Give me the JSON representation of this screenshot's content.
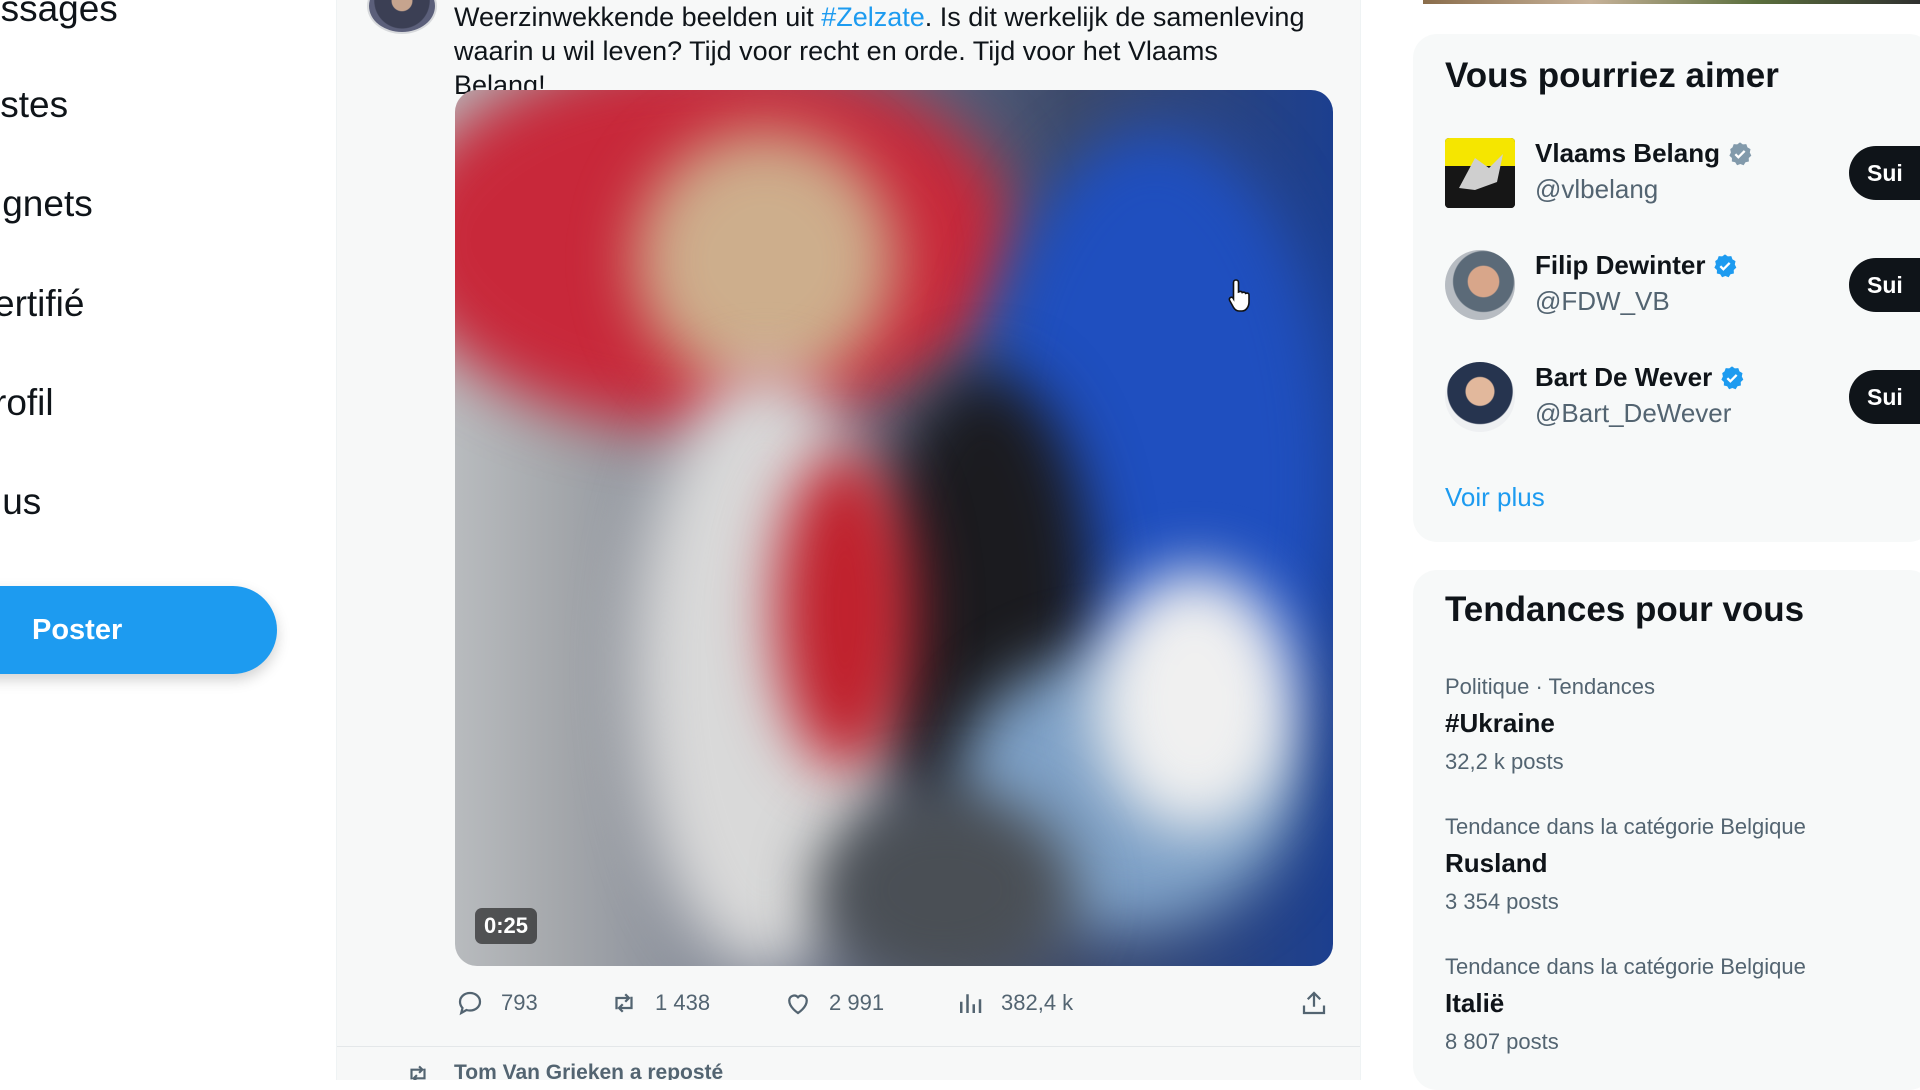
{
  "nav": {
    "items": [
      "essages",
      "istes",
      "ignets",
      "ertifié",
      "rofil",
      "lus"
    ],
    "poster_label": "Poster"
  },
  "tweet": {
    "text_before": "Weerzinwekkende beelden uit ",
    "hashtag": "#Zelzate",
    "text_after": ". Is dit werkelijk de samenleving waarin u wil leven? Tijd voor recht en orde. Tijd voor het Vlaams Belang!",
    "media_duration": "0:25",
    "replies": "793",
    "reposts": "1 438",
    "likes": "2 991",
    "views": "382,4 k",
    "next_repost_label": "Tom Van Grieken a reposté"
  },
  "suggestions": {
    "title": "Vous pourriez aimer",
    "follow_label": "Sui",
    "items": [
      {
        "name": "Vlaams Belang",
        "handle": "@vlbelang"
      },
      {
        "name": "Filip Dewinter",
        "handle": "@FDW_VB"
      },
      {
        "name": "Bart De Wever",
        "handle": "@Bart_DeWever"
      }
    ],
    "more_label": "Voir plus"
  },
  "trends": {
    "title": "Tendances pour vous",
    "items": [
      {
        "meta": "Politique · Tendances",
        "name": "#Ukraine",
        "count": "32,2 k posts"
      },
      {
        "meta": "Tendance dans la catégorie Belgique",
        "name": "Rusland",
        "count": "3 354 posts"
      },
      {
        "meta": "Tendance dans la catégorie Belgique",
        "name": "Italië",
        "count": "8 807 posts"
      }
    ]
  },
  "colors": {
    "accent": "#1d9bf0",
    "follow_button": "#0f1419",
    "secondary_text": "#536471"
  },
  "icons": [
    "reply-icon",
    "repost-icon",
    "like-icon",
    "views-icon",
    "share-icon",
    "verified-icon",
    "pointer-cursor-icon"
  ]
}
